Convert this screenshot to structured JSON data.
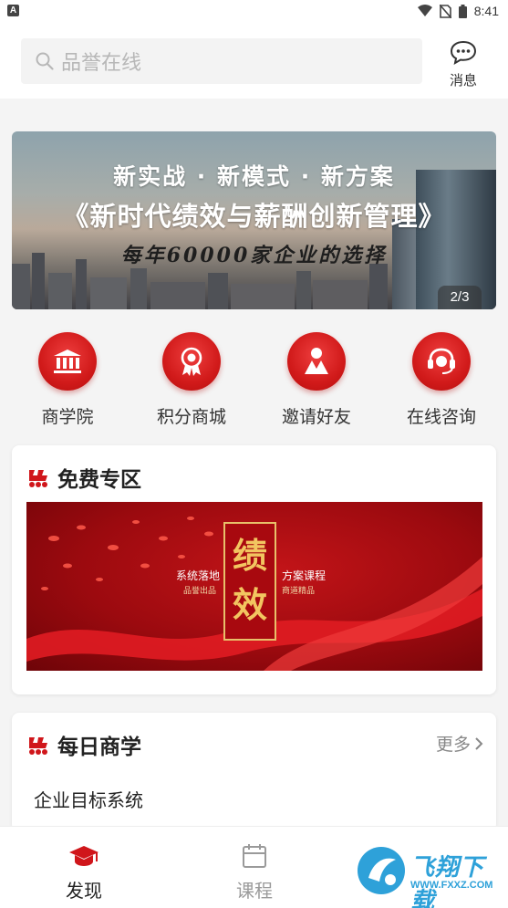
{
  "status_bar": {
    "left_badge": "A",
    "time": "8:41"
  },
  "search": {
    "placeholder": "品誉在线"
  },
  "header": {
    "message_label": "消息"
  },
  "banner": {
    "line1": "新实战 · 新模式 · 新方案",
    "line2": "《新时代绩效与薪酬创新管理》",
    "line3": "每年60000家企业的选择",
    "pager": "2/3"
  },
  "quick_links": [
    {
      "label": "商学院",
      "icon": "bank-icon"
    },
    {
      "label": "积分商城",
      "icon": "medal-icon"
    },
    {
      "label": "邀请好友",
      "icon": "person-icon"
    },
    {
      "label": "在线咨询",
      "icon": "headset-icon"
    }
  ],
  "free_zone": {
    "title": "免费专区",
    "promo": {
      "char1": "绩",
      "char2": "效",
      "left_main": "系统落地",
      "left_sub": "品誉出品",
      "right_main": "方案课程",
      "right_sub": "商道精品"
    }
  },
  "daily": {
    "title": "每日商学",
    "more": "更多",
    "items": [
      {
        "title": "企业目标系统"
      }
    ]
  },
  "tabbar": {
    "tabs": [
      {
        "label": "发现",
        "icon": "graduation-cap-icon",
        "active": true
      },
      {
        "label": "课程",
        "icon": "calendar-icon",
        "active": false
      }
    ],
    "watermark_main": "飞翔下载",
    "watermark_url": "WWW.FXXZ.COM"
  },
  "colors": {
    "accent": "#d0161b",
    "active_tab": "#222222",
    "inactive_tab": "#9a9a9a"
  }
}
